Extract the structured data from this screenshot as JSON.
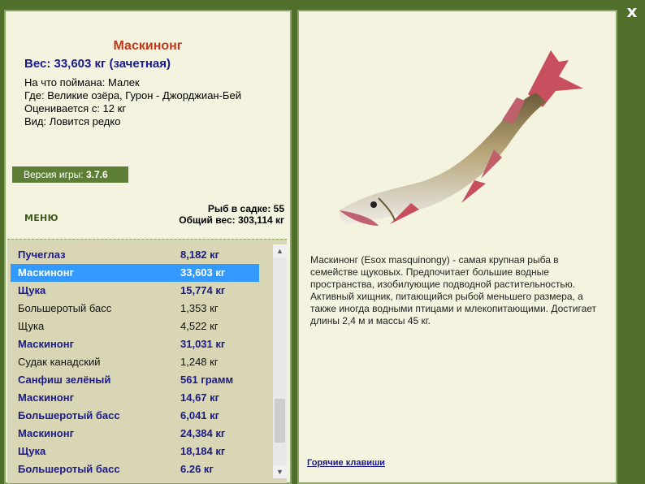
{
  "window": {
    "close_label": "x"
  },
  "fish": {
    "title": "Маскинонг",
    "weight": "Вес: 33,603 кг (зачетная)",
    "bait": "На что поймана: Малек",
    "location": "Где: Великие озёра, Гурон - Джорджиан-Бей",
    "rated_from": "Оценивается с: 12 кг",
    "rarity": "Вид: Ловится редко",
    "description": "Маскинонг (Esox masquinongy) - самая крупная рыба в семействе щуковых. Предпочитает большие водные пространства, изобилующие подводной растительностью. Активный хищник, питающийся рыбой меньшего размера, а также иногда водными птицами и млекопитающими. Достигает длины 2,4 м и массы 45 кг."
  },
  "version": {
    "label": "Версия игры:",
    "value": "3.7.6"
  },
  "menu": {
    "label": "МЕНЮ"
  },
  "tank": {
    "count": "Рыб в садке: 55",
    "total_weight": "Общий вес: 303,114 кг"
  },
  "catch_list": [
    {
      "name": "Пучеглаз",
      "weight": "8,182 кг",
      "style": "bold"
    },
    {
      "name": "Маскинонг",
      "weight": "33,603 кг",
      "style": "sel"
    },
    {
      "name": "Щука",
      "weight": "15,774 кг",
      "style": "bold"
    },
    {
      "name": "Большеротый басс",
      "weight": "1,353 кг",
      "style": "norm"
    },
    {
      "name": "Щука",
      "weight": "4,522 кг",
      "style": "norm"
    },
    {
      "name": "Маскинонг",
      "weight": "31,031 кг",
      "style": "bold"
    },
    {
      "name": "Судак канадский",
      "weight": "1,248 кг",
      "style": "norm"
    },
    {
      "name": "Санфиш зелёный",
      "weight": "561 грамм",
      "style": "bold"
    },
    {
      "name": "Маскинонг",
      "weight": "14,67 кг",
      "style": "bold"
    },
    {
      "name": "Большеротый басс",
      "weight": "6,041 кг",
      "style": "bold"
    },
    {
      "name": "Маскинонг",
      "weight": "24,384 кг",
      "style": "bold"
    },
    {
      "name": "Щука",
      "weight": "18,184 кг",
      "style": "bold"
    },
    {
      "name": "Большеротый басс",
      "weight": "6.26 кг",
      "style": "bold"
    }
  ],
  "hotkeys": {
    "label": "Горячие клавиши"
  },
  "colors": {
    "background": "#4f6f2b",
    "panel": "#f3f3df",
    "list_bg": "#d9d6b6",
    "selection": "#3399ff",
    "title": "#c0391b",
    "accent_text": "#1a1a8a"
  }
}
